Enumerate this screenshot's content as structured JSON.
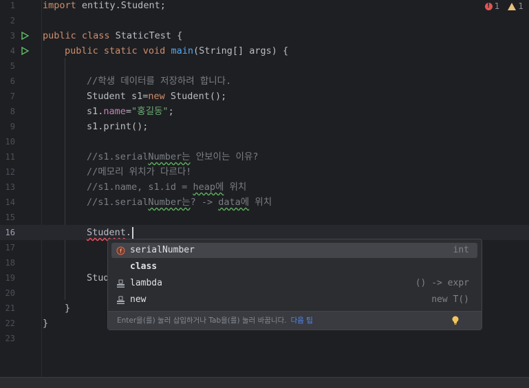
{
  "indicators": {
    "errors": "1",
    "warnings": "1"
  },
  "lines": [
    {
      "num": "1"
    },
    {
      "num": "2"
    },
    {
      "num": "3"
    },
    {
      "num": "4"
    },
    {
      "num": "5"
    },
    {
      "num": "6"
    },
    {
      "num": "7"
    },
    {
      "num": "8"
    },
    {
      "num": "9"
    },
    {
      "num": "10"
    },
    {
      "num": "11"
    },
    {
      "num": "12"
    },
    {
      "num": "13"
    },
    {
      "num": "14"
    },
    {
      "num": "15"
    },
    {
      "num": "16"
    },
    {
      "num": "17"
    },
    {
      "num": "18"
    },
    {
      "num": "19"
    },
    {
      "num": "20"
    },
    {
      "num": "21"
    },
    {
      "num": "22"
    },
    {
      "num": "23"
    }
  ],
  "code": {
    "l1": {
      "kw": "import",
      "rest": " entity.Student;"
    },
    "l3": {
      "kw": "public class",
      "rest": " StaticTest {"
    },
    "l4": {
      "kw": "public static void",
      "fn": "main",
      "rest": "(String[] args) {"
    },
    "l6": {
      "comment": "//학생 데이터를 저장하려 합니다."
    },
    "l7": {
      "a": "Student s1=",
      "kw": "new",
      "b": " Student();"
    },
    "l8": {
      "a": "s1.",
      "field": "name",
      "b": "=",
      "str": "\"홍길동\"",
      "c": ";"
    },
    "l9": {
      "a": "s1.print();"
    },
    "l11": {
      "a": "//s1.serial",
      "typo": "Number는",
      "b": " 안보이는 이유?"
    },
    "l12": {
      "comment": "//메모리 위치가 다르다!"
    },
    "l13": {
      "a": "//s1.name, s1.id = ",
      "typo": "heap에",
      "b": " 위치"
    },
    "l14": {
      "a": "//s1.serial",
      "typo1": "Number는",
      "b": "? -> ",
      "typo2": "data에",
      "c": " 위치"
    },
    "l16": {
      "err": "Student",
      "rest": "."
    },
    "l19": {
      "a": "Stud"
    },
    "l21": {
      "a": "}"
    },
    "l22": {
      "a": "}"
    }
  },
  "completion": {
    "items": [
      {
        "name": "serialNumber",
        "type": "int",
        "icon": "field-icon"
      },
      {
        "name": "class",
        "type": "",
        "icon": "none"
      },
      {
        "name": "lambda",
        "type": "() -> expr",
        "icon": "template-icon"
      },
      {
        "name": "new",
        "type": "new T()",
        "icon": "template-icon"
      }
    ],
    "hint": "Enter을(를) 눌러 삽입하거나 Tab을(를) 눌러 바꿉니다.",
    "tip_link": "다음 팁",
    "bulb_icon": "lightbulb-icon"
  },
  "colors": {
    "keyword": "#cf8e6d",
    "function": "#56a8f5",
    "field": "#c77dbb",
    "string": "#6aab73",
    "comment": "#7a7e85",
    "link": "#548af7"
  }
}
